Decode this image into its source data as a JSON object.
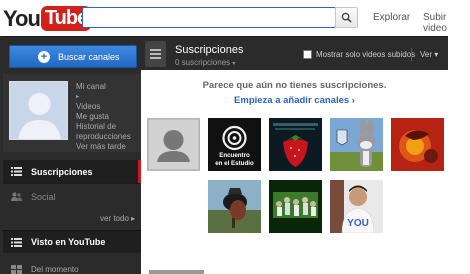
{
  "header": {
    "logo_you": "You",
    "logo_tube": "Tube",
    "search_placeholder": "",
    "explore": "Explorar",
    "upload": "Subir video"
  },
  "guide": {
    "add_channels": "Buscar canales",
    "profile_links": [
      {
        "label": "Mi canal",
        "arrow": "▸"
      },
      {
        "label": "Videos",
        "arrow": ""
      },
      {
        "label": "Me gusta",
        "arrow": ""
      },
      {
        "label": "Historial de reproducciones",
        "arrow": ""
      },
      {
        "label": "Ver más tarde",
        "arrow": ""
      }
    ],
    "subscriptions": "Suscripciones",
    "social": "Social",
    "see_all": "ver todo ▸",
    "watched": "Visto en YouTube",
    "moment": "Del momento"
  },
  "subbar": {
    "title": "Suscripciones",
    "count": "0 suscripciones",
    "count_arrow": "▾",
    "only_uploads": "Mostrar solo videos subidos",
    "view": "Ver ▾"
  },
  "main": {
    "empty_message": "Parece que aún no tienes suscripciones.",
    "add_link": "Empieza a añadir canales ›",
    "channels": [
      {
        "name": "default-channel",
        "text": ""
      },
      {
        "name": "encuentro-en-el-estudio",
        "text": "Encuentro en el Estudio"
      },
      {
        "name": "red-strawberry",
        "text": ""
      },
      {
        "name": "bugs-bunny",
        "text": ""
      },
      {
        "name": "red-album-art",
        "text": ""
      },
      {
        "name": "bird-with-hat",
        "text": ""
      },
      {
        "name": "dancing-crowd",
        "text": ""
      },
      {
        "name": "you-shirt-person",
        "text": "YOU"
      }
    ]
  },
  "colors": {
    "brand_red": "#d4201a",
    "accent_blue": "#2a64c5",
    "guide_bg": "#2b2b2b",
    "active_marker": "#cc181e"
  }
}
